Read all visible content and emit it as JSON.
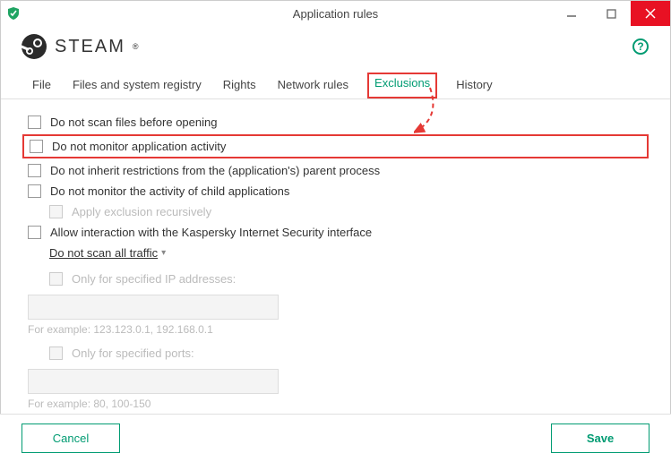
{
  "window": {
    "title": "Application rules"
  },
  "app": {
    "name": "STEAM"
  },
  "tabs": {
    "file": "File",
    "registry": "Files and system registry",
    "rights": "Rights",
    "network": "Network rules",
    "exclusions": "Exclusions",
    "history": "History"
  },
  "options": {
    "noScanBeforeOpen": "Do not scan files before opening",
    "noMonitorActivity": "Do not monitor application activity",
    "noInheritRestrictions": "Do not inherit restrictions from the (application's) parent process",
    "noMonitorChild": "Do not monitor the activity of child applications",
    "applyRecursively": "Apply exclusion recursively",
    "allowInteraction": "Allow interaction with the Kaspersky Internet Security interface",
    "noScanTraffic": "Do not scan all traffic",
    "onlyIP": "Only for specified IP addresses:",
    "ipHint": "For example: 123.123.0.1, 192.168.0.1",
    "onlyPorts": "Only for specified ports:",
    "portsHint": "For example: 80, 100-150"
  },
  "buttons": {
    "cancel": "Cancel",
    "save": "Save"
  }
}
